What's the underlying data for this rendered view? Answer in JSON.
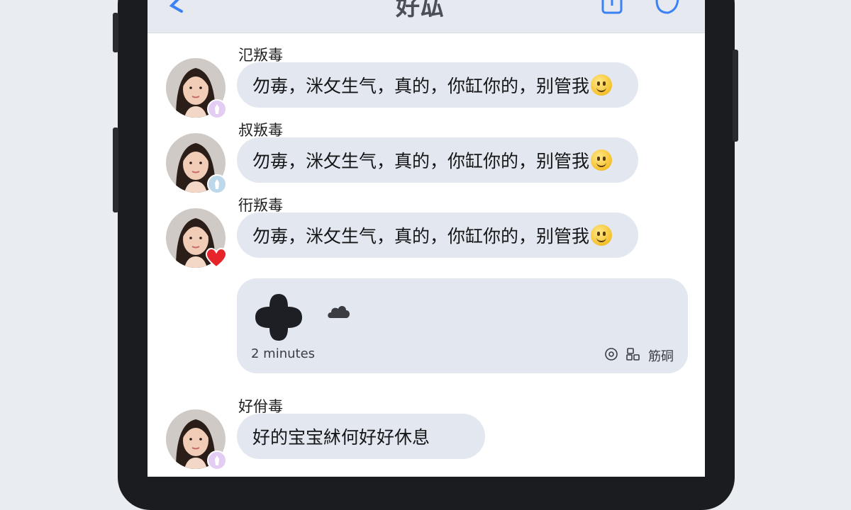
{
  "nav": {
    "title": "好厸",
    "back_icon": "chevron-left-icon",
    "right_icons": [
      "compose-icon",
      "sticker-icon"
    ]
  },
  "messages": [
    {
      "sender": "氾叛毒",
      "text": "勿毐，洣攵生气，真的，你缸你的，别管我",
      "emoji": "slightly-smiling-face",
      "badge": "lavender-sticker",
      "badge_color": "#e3cdf2"
    },
    {
      "sender": "叔叛毒",
      "text": "勿毐，洣攵生气，真的，你缸你的，别管我",
      "emoji": "slightly-smiling-face",
      "badge": "blue-sticker",
      "badge_color": "#bcd8ea"
    },
    {
      "sender": "衎叛毒",
      "text": "勿毐，洣攵生气，真的，你缸你的，别管我",
      "emoji": "slightly-smiling-face",
      "badge": "heart",
      "badge_color": "#e8242b"
    },
    {
      "sender": "好佾毒",
      "text": "好的宝宝絉何好好休息",
      "emoji": "",
      "badge": "lavender-sticker",
      "badge_color": "#e3cdf2"
    }
  ],
  "card": {
    "time": "2 minutes",
    "meta_label": "筋硐",
    "icons": [
      "plus-shape-icon",
      "small-cloud-icon",
      "clock-icon",
      "link-icon"
    ]
  },
  "colors": {
    "bubble": "#e3e7ef",
    "navbar": "#e6e9ef",
    "back_accent": "#3b82f6"
  }
}
